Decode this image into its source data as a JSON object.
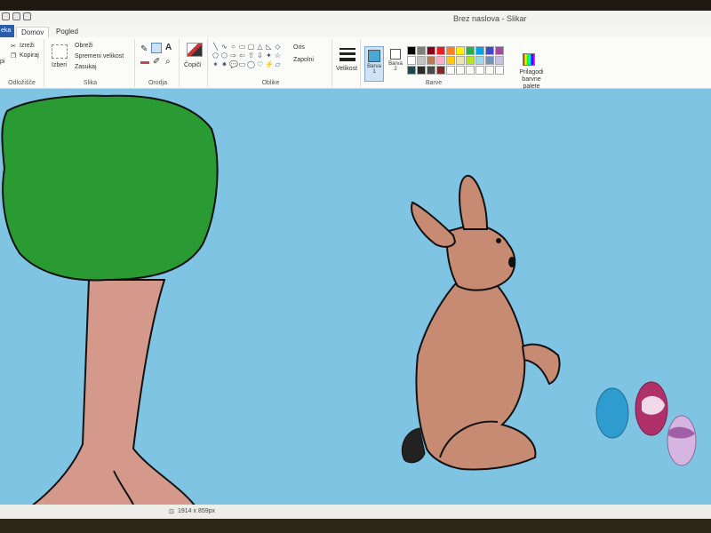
{
  "window": {
    "title": "Brez naslova - Slikar"
  },
  "tabs": {
    "file": "eka",
    "home": "Domov",
    "view": "Pogled"
  },
  "clipboard": {
    "paste_partial": "pi",
    "cut": "Izreži",
    "copy": "Kopiraj",
    "group": "Odložišče"
  },
  "image": {
    "select": "Izberi",
    "crop": "Obreži",
    "resize": "Spremeni velikost",
    "rotate": "Zasukaj",
    "group": "Slika"
  },
  "tools": {
    "group": "Orodja"
  },
  "brushes": {
    "label": "Čopiči"
  },
  "shapes": {
    "outline": "Oris",
    "fill": "Zapolni",
    "group": "Oblike"
  },
  "size": {
    "label": "Velikost"
  },
  "colors": {
    "color1": "Barva 1",
    "color2": "Barva 2",
    "group": "Barve",
    "edit": "Prilagodi barvne palete",
    "color1_value": "#4aa8d6",
    "color2_value": "#ffffff",
    "palette": [
      "#000000",
      "#7f7f7f",
      "#880015",
      "#ed1c24",
      "#ff7f27",
      "#fff200",
      "#22b14c",
      "#00a2e8",
      "#3f48cc",
      "#a349a4",
      "#ffffff",
      "#c3c3c3",
      "#b97a57",
      "#ffaec9",
      "#ffc90e",
      "#efe4b0",
      "#b5e61d",
      "#99d9ea",
      "#7092be",
      "#c8bfe7",
      "#1a4a4a",
      "#2a2a2a",
      "#4a4a4a",
      "#7a2a2a",
      "#ffffff",
      "#ffffff",
      "#ffffff",
      "#ffffff",
      "#ffffff",
      "#ffffff"
    ]
  },
  "status": {
    "dimensions": "1914 x 859px"
  },
  "accent": "#2a5ea8",
  "canvas_bg": "#7fc5e3"
}
